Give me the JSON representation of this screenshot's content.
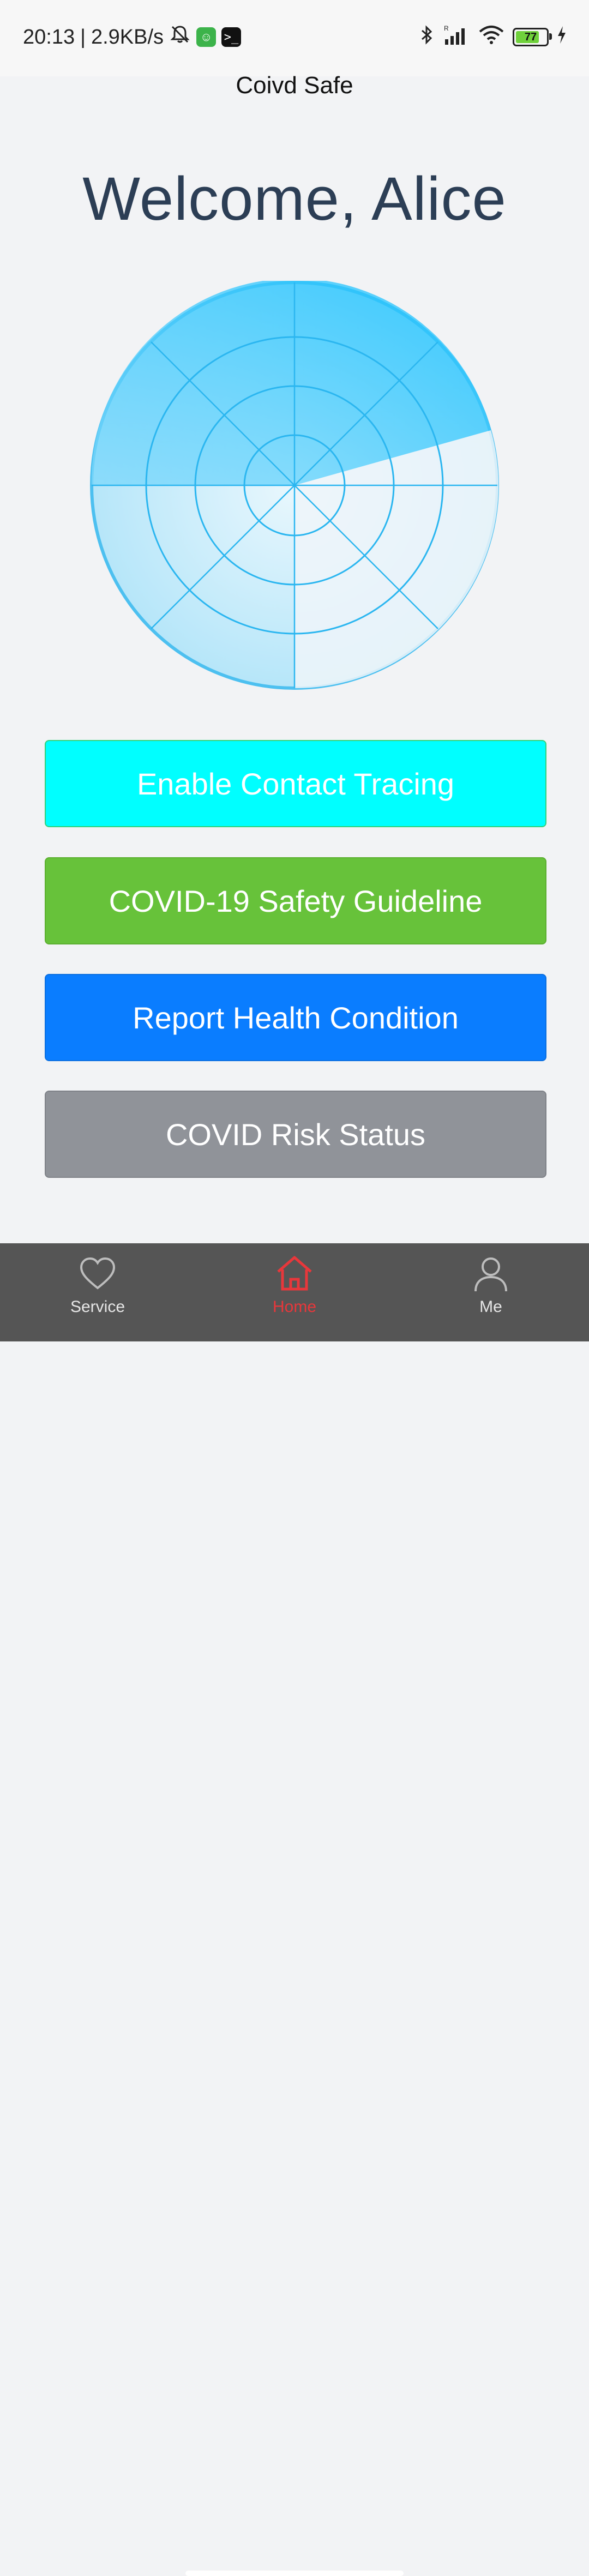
{
  "status_bar": {
    "time": "20:13",
    "separator": "|",
    "network_speed": "2.9KB/s",
    "battery_level": "77",
    "icons": [
      "mute-icon",
      "app-green-icon",
      "terminal-icon",
      "bluetooth-icon",
      "signal-icon",
      "wifi-icon",
      "battery-icon",
      "charging-icon"
    ]
  },
  "header": {
    "title": "Coivd Safe"
  },
  "welcome": {
    "text": "Welcome, Alice"
  },
  "radar": {
    "icon": "radar-scan-icon",
    "accent": "#19c2ff"
  },
  "buttons": [
    {
      "label": "Enable Contact Tracing",
      "color": "#00ffff"
    },
    {
      "label": "COVID-19 Safety Guideline",
      "color": "#67c23a"
    },
    {
      "label": "Report Health Condition",
      "color": "#0a7dff"
    },
    {
      "label": "COVID Risk Status",
      "color": "#909399"
    }
  ],
  "tabbar": {
    "tabs": [
      {
        "label": "Service",
        "icon": "heart-icon",
        "active": false
      },
      {
        "label": "Home",
        "icon": "home-icon",
        "active": true
      },
      {
        "label": "Me",
        "icon": "person-icon",
        "active": false
      }
    ],
    "active_color": "#e8373b"
  }
}
